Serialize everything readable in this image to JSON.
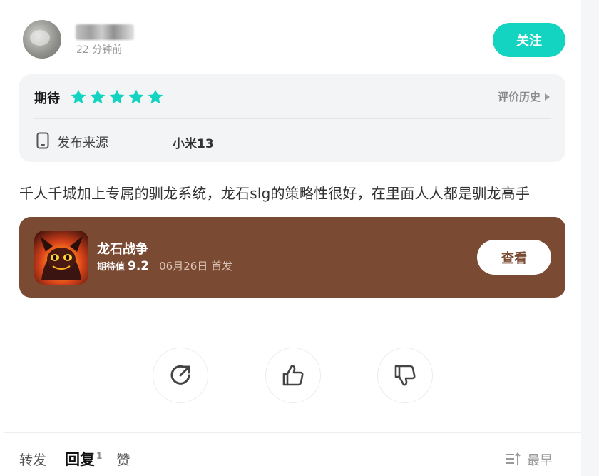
{
  "header": {
    "timestamp": "22 分钟前",
    "follow_label": "关注"
  },
  "rating": {
    "label": "期待",
    "stars": 5,
    "history_label": "评价历史",
    "source_label": "发布来源",
    "source_value": "小米13",
    "star_color": "#13d4c0"
  },
  "review": {
    "text": "千人千城加上专属的驯龙系统，龙石slg的策略性很好，在里面人人都是驯龙高手"
  },
  "game": {
    "name": "龙石战争",
    "expect_label": "期待值",
    "expect_score": "9.2",
    "release": "06月26日 首发",
    "view_label": "查看",
    "card_color": "#7b4a32"
  },
  "actions": [
    {
      "name": "share",
      "icon": "share-icon"
    },
    {
      "name": "like",
      "icon": "thumbs-up-icon"
    },
    {
      "name": "dislike",
      "icon": "thumbs-down-icon"
    }
  ],
  "tabs": {
    "repost": "转发",
    "reply": "回复",
    "reply_count": "1",
    "like": "赞",
    "sort_label": "最早"
  },
  "colors": {
    "accent": "#13d4c0",
    "game_card": "#7b4a32"
  }
}
